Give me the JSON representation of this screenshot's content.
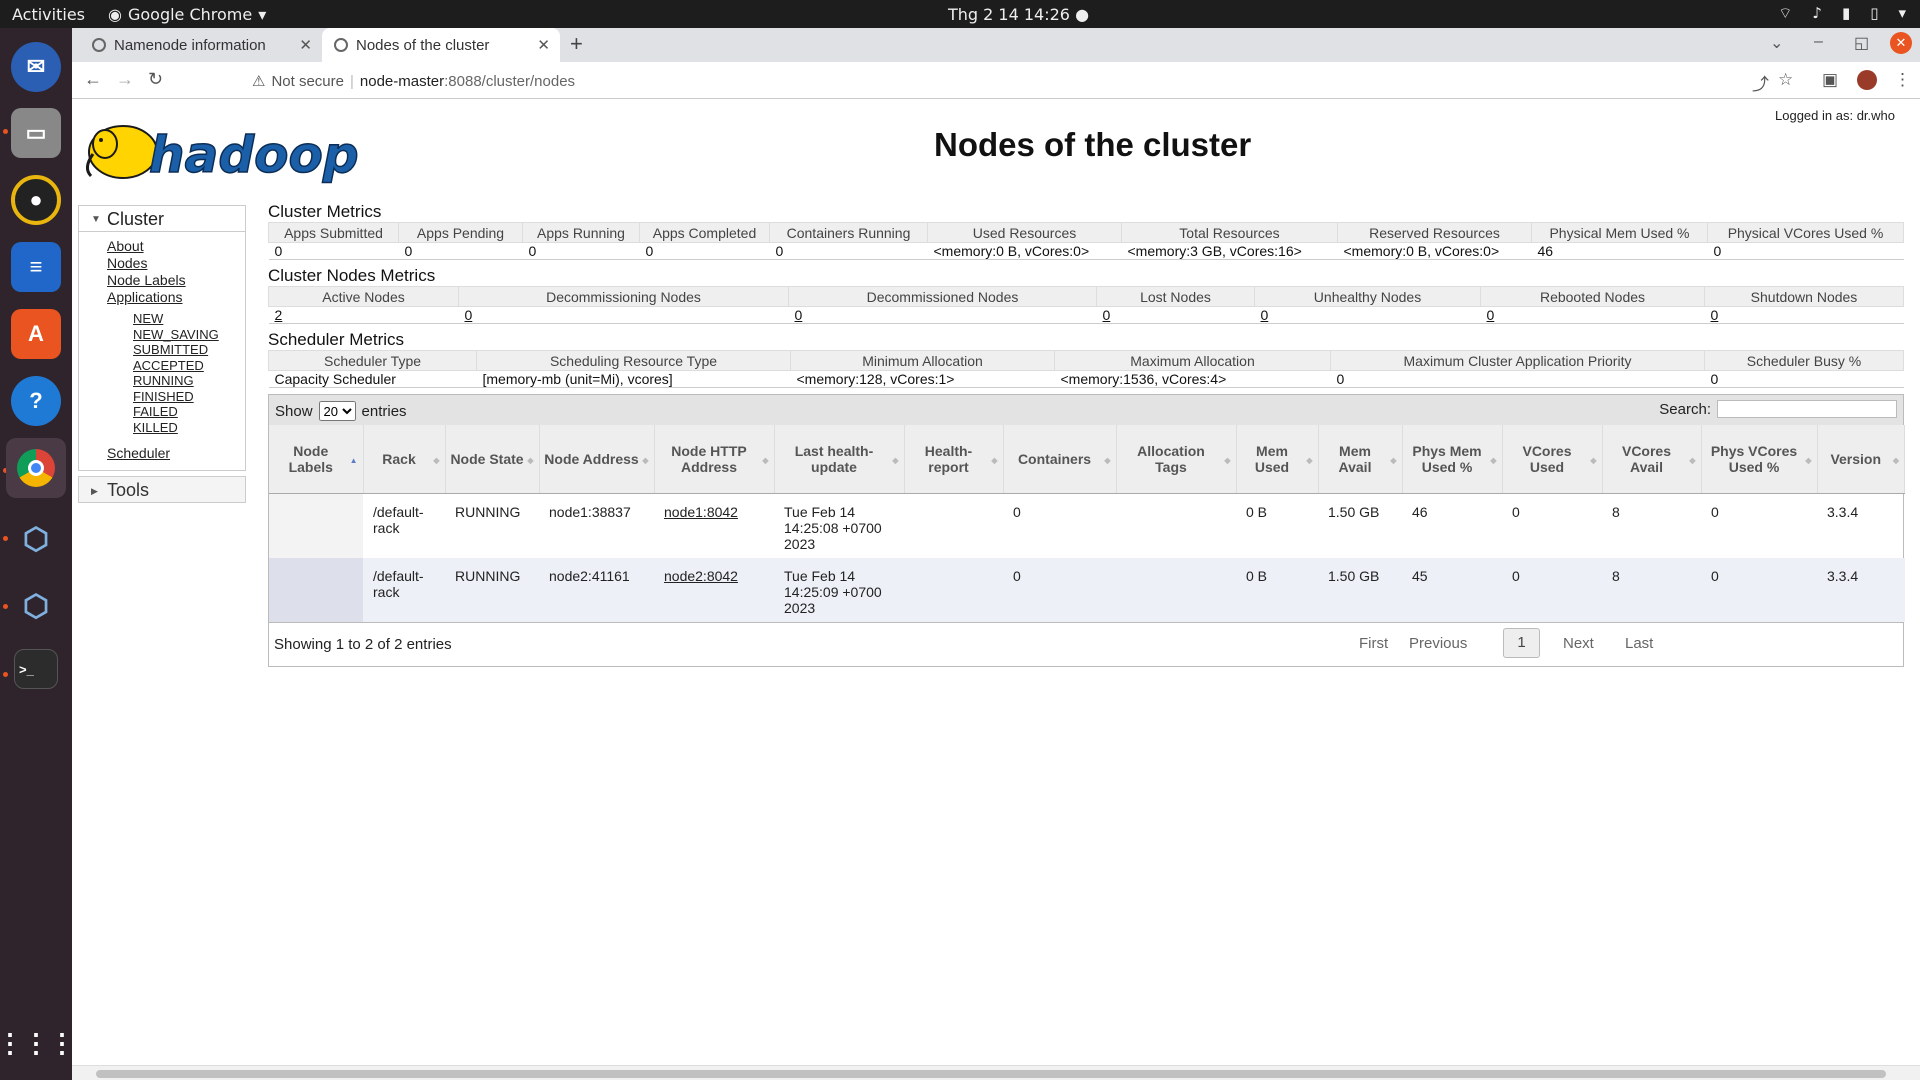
{
  "os": {
    "activities": "Activities",
    "app_name": "Google Chrome",
    "clock": "Thg 2 14  14:26"
  },
  "browser": {
    "tabs": [
      {
        "label": "Namenode information"
      },
      {
        "label": "Nodes of the cluster"
      }
    ],
    "not_secure": "Not secure",
    "url_host": "node-master",
    "url_path": ":8088/cluster/nodes"
  },
  "page": {
    "title": "Nodes of the cluster",
    "logged_in": "Logged in as: dr.who",
    "logo_text": "hadoop"
  },
  "sidebar": {
    "cluster_label": "Cluster",
    "links": [
      "About",
      "Nodes",
      "Node Labels",
      "Applications"
    ],
    "app_states": [
      "NEW",
      "NEW_SAVING",
      "SUBMITTED",
      "ACCEPTED",
      "RUNNING",
      "FINISHED",
      "FAILED",
      "KILLED"
    ],
    "scheduler": "Scheduler",
    "tools_label": "Tools"
  },
  "cluster_metrics": {
    "title": "Cluster Metrics",
    "headers": [
      "Apps Submitted",
      "Apps Pending",
      "Apps Running",
      "Apps Completed",
      "Containers Running",
      "Used Resources",
      "Total Resources",
      "Reserved Resources",
      "Physical Mem Used %",
      "Physical VCores Used %"
    ],
    "values": [
      "0",
      "0",
      "0",
      "0",
      "0",
      "<memory:0 B, vCores:0>",
      "<memory:3 GB, vCores:16>",
      "<memory:0 B, vCores:0>",
      "46",
      "0"
    ]
  },
  "node_metrics": {
    "title": "Cluster Nodes Metrics",
    "headers": [
      "Active Nodes",
      "Decommissioning Nodes",
      "Decommissioned Nodes",
      "Lost Nodes",
      "Unhealthy Nodes",
      "Rebooted Nodes",
      "Shutdown Nodes"
    ],
    "values": [
      "2",
      "0",
      "0",
      "0",
      "0",
      "0",
      "0"
    ]
  },
  "scheduler_metrics": {
    "title": "Scheduler Metrics",
    "headers": [
      "Scheduler Type",
      "Scheduling Resource Type",
      "Minimum Allocation",
      "Maximum Allocation",
      "Maximum Cluster Application Priority",
      "Scheduler Busy %"
    ],
    "values": [
      "Capacity Scheduler",
      "[memory-mb (unit=Mi), vcores]",
      "<memory:128, vCores:1>",
      "<memory:1536, vCores:4>",
      "0",
      "0"
    ]
  },
  "nodes_table": {
    "show_label": "Show",
    "entries_label": "entries",
    "page_size": "20",
    "search_label": "Search:",
    "headers": [
      "Node Labels",
      "Rack",
      "Node State",
      "Node Address",
      "Node HTTP Address",
      "Last health-update",
      "Health-report",
      "Containers",
      "Allocation Tags",
      "Mem Used",
      "Mem Avail",
      "Phys Mem Used %",
      "VCores Used",
      "VCores Avail",
      "Phys VCores Used %",
      "Version"
    ],
    "rows": [
      {
        "labels": "",
        "rack": "/default-rack",
        "state": "RUNNING",
        "address": "node1:38837",
        "http": "node1:8042",
        "health_update": "Tue Feb 14 14:25:08 +0700 2023",
        "health_report": "",
        "containers": "0",
        "tags": "",
        "mem_used": "0 B",
        "mem_avail": "1.50 GB",
        "phys_mem": "46",
        "vcores_used": "0",
        "vcores_avail": "8",
        "phys_vcores": "0",
        "version": "3.3.4"
      },
      {
        "labels": "",
        "rack": "/default-rack",
        "state": "RUNNING",
        "address": "node2:41161",
        "http": "node2:8042",
        "health_update": "Tue Feb 14 14:25:09 +0700 2023",
        "health_report": "",
        "containers": "0",
        "tags": "",
        "mem_used": "0 B",
        "mem_avail": "1.50 GB",
        "phys_mem": "45",
        "vcores_used": "0",
        "vcores_avail": "8",
        "phys_vcores": "0",
        "version": "3.3.4"
      }
    ],
    "info": "Showing 1 to 2 of 2 entries",
    "pagination": {
      "first": "First",
      "previous": "Previous",
      "current": "1",
      "next": "Next",
      "last": "Last"
    }
  }
}
